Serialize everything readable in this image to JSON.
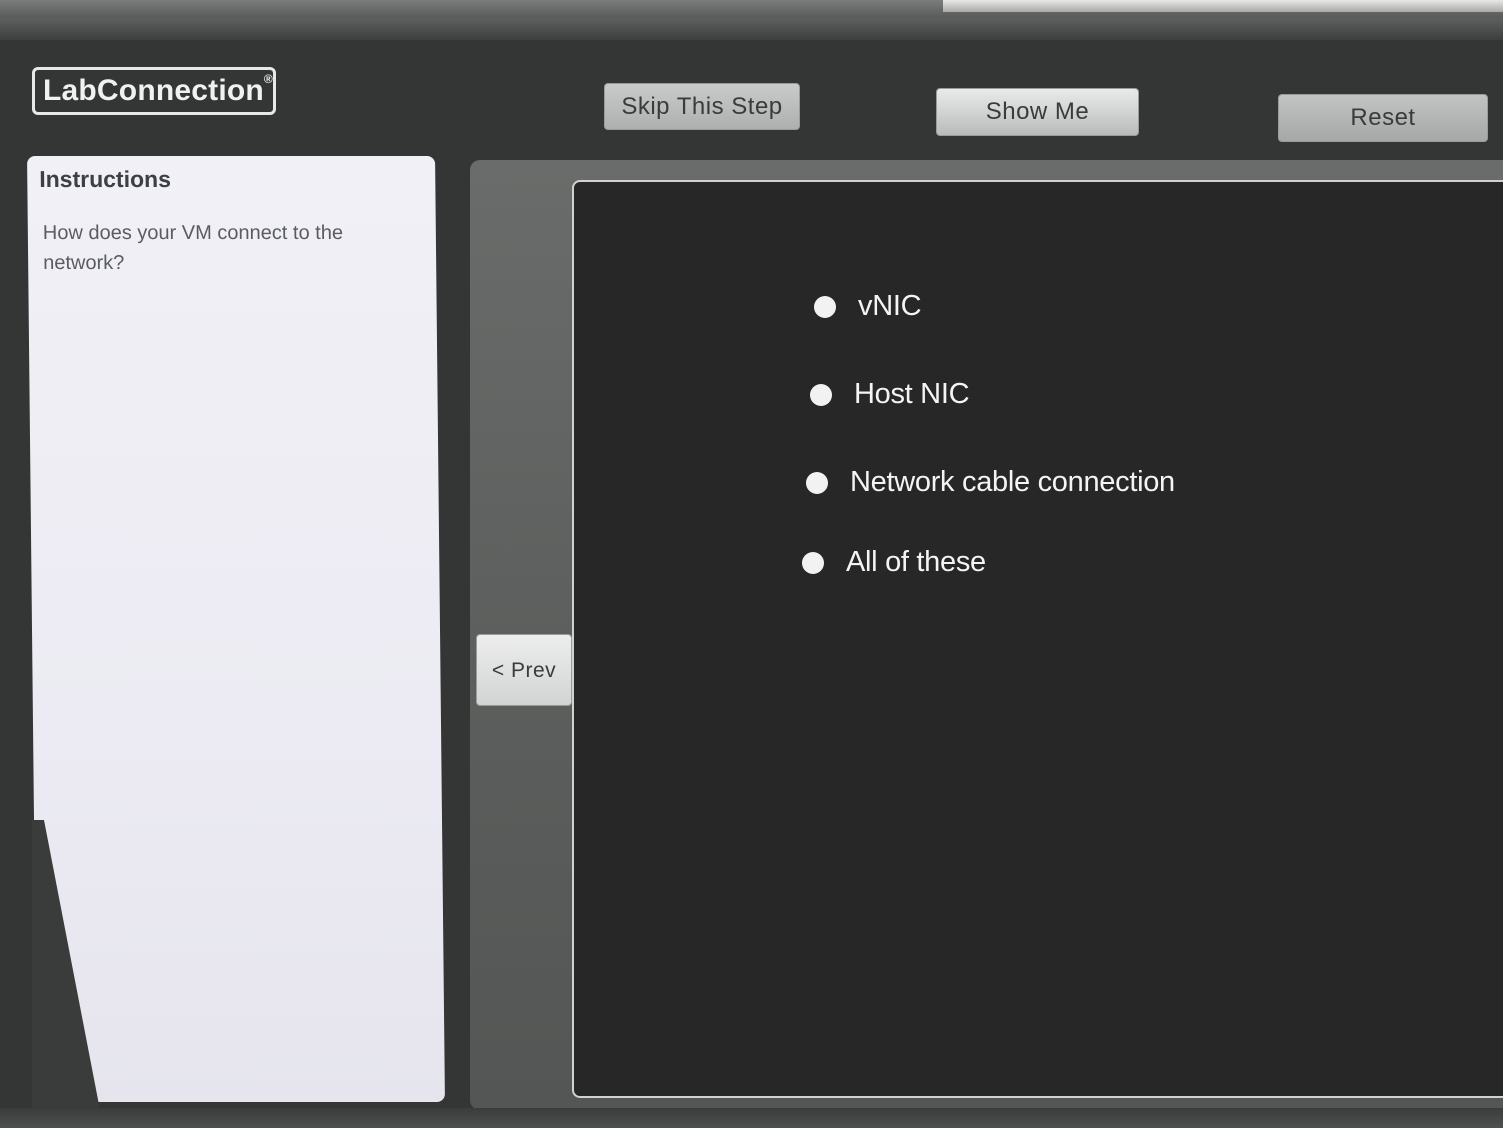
{
  "app": {
    "logo_text": "LabConnection",
    "logo_mark": "®"
  },
  "toolbar": {
    "skip_label": "Skip This Step",
    "show_me_label": "Show Me",
    "reset_label": "Reset"
  },
  "instructions": {
    "title": "Instructions",
    "text": "How does your VM connect to the network?"
  },
  "navigation": {
    "prev_label": "< Prev"
  },
  "question": {
    "options": [
      {
        "label": "vNIC"
      },
      {
        "label": "Host NIC"
      },
      {
        "label": "Network cable connection"
      },
      {
        "label": "All of these"
      }
    ]
  },
  "colors": {
    "background": "#343635",
    "question_area": "#262726",
    "instructions_panel": "#eeedf4",
    "button": "#d7d9d9"
  }
}
